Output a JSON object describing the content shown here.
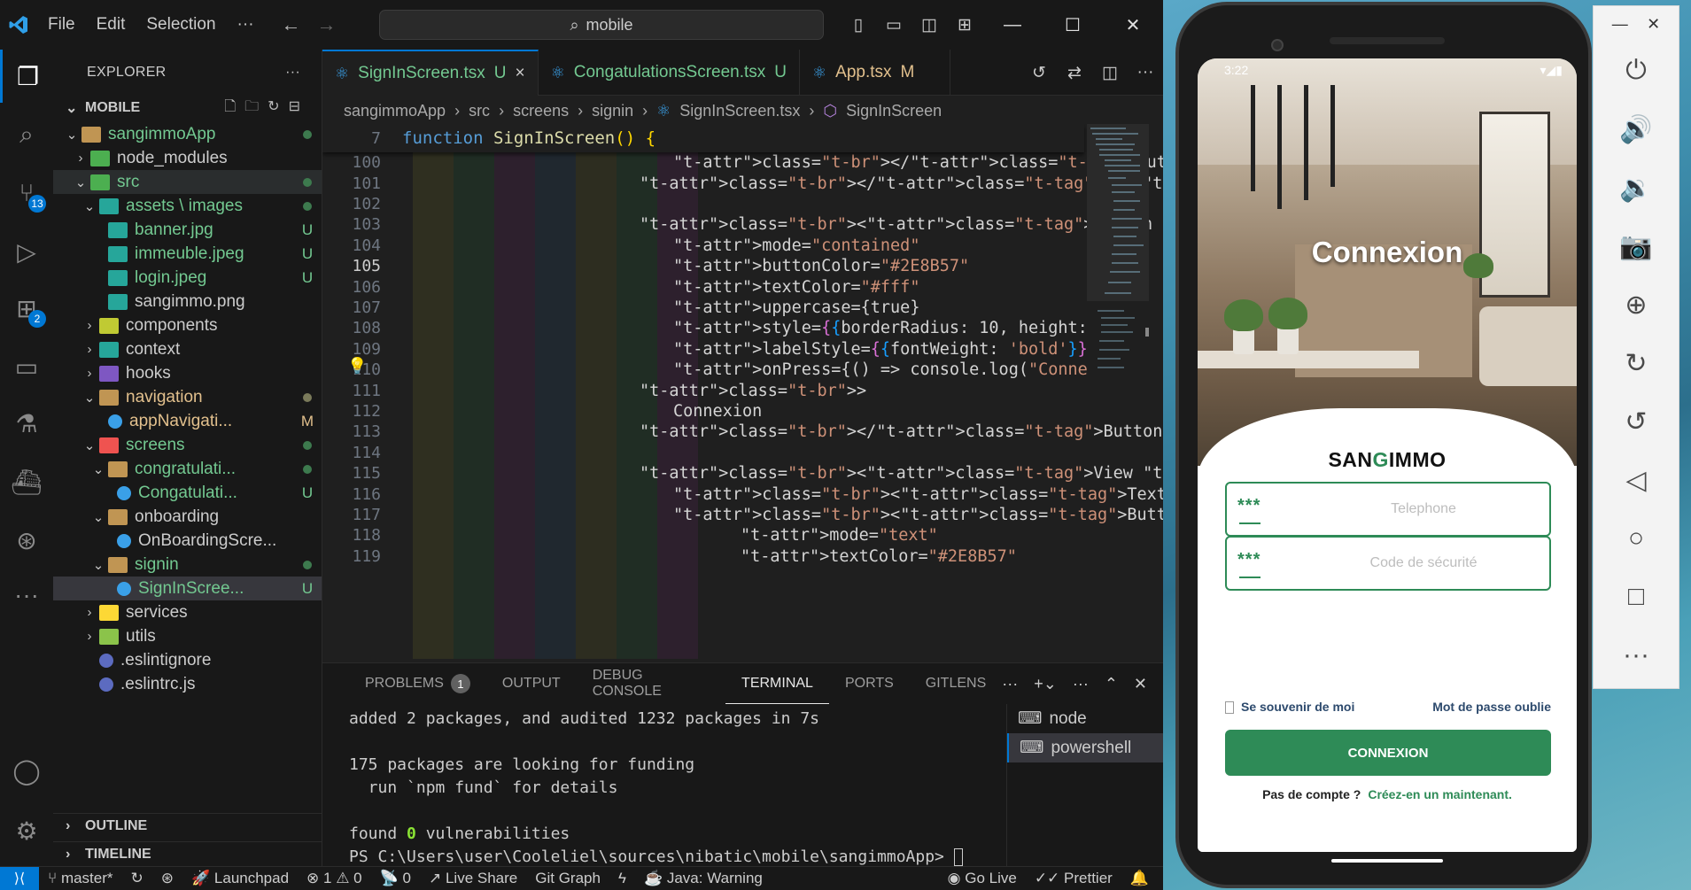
{
  "titlebar": {
    "menu": [
      "File",
      "Edit",
      "Selection",
      "···"
    ],
    "search": "mobile"
  },
  "activity": {
    "scm_badge": "13",
    "ext_badge": "2"
  },
  "explorer": {
    "title": "EXPLORER",
    "section": "MOBILE",
    "outline": "OUTLINE",
    "timeline": "TIMELINE",
    "tree": [
      {
        "label": "sangimmoApp",
        "depth": 1,
        "twisty": "v",
        "status": "dot",
        "icon": "folder"
      },
      {
        "label": "node_modules",
        "depth": 2,
        "twisty": ">",
        "status": "",
        "icon": "folder-green"
      },
      {
        "label": "src",
        "depth": 2,
        "twisty": "v",
        "status": "dot",
        "icon": "folder-src",
        "hover": true
      },
      {
        "label": "assets \\ images",
        "depth": 3,
        "twisty": "v",
        "status": "dot",
        "icon": "folder-images"
      },
      {
        "label": "banner.jpg",
        "depth": 4,
        "twisty": "",
        "status": "U",
        "icon": "image"
      },
      {
        "label": "immeuble.jpeg",
        "depth": 4,
        "twisty": "",
        "status": "U",
        "icon": "image"
      },
      {
        "label": "login.jpeg",
        "depth": 4,
        "twisty": "",
        "status": "U",
        "icon": "image"
      },
      {
        "label": "sangimmo.png",
        "depth": 4,
        "twisty": "",
        "status": "",
        "icon": "image"
      },
      {
        "label": "components",
        "depth": 3,
        "twisty": ">",
        "status": "",
        "icon": "folder-components"
      },
      {
        "label": "context",
        "depth": 3,
        "twisty": ">",
        "status": "",
        "icon": "folder-context"
      },
      {
        "label": "hooks",
        "depth": 3,
        "twisty": ">",
        "status": "",
        "icon": "folder-hooks"
      },
      {
        "label": "navigation",
        "depth": 3,
        "twisty": "v",
        "status": "dot-mod",
        "icon": "folder"
      },
      {
        "label": "appNavigati...",
        "depth": 4,
        "twisty": "",
        "status": "M",
        "icon": "react"
      },
      {
        "label": "screens",
        "depth": 3,
        "twisty": "v",
        "status": "dot",
        "icon": "folder-screens"
      },
      {
        "label": "congratulati...",
        "depth": 4,
        "twisty": "v",
        "status": "dot",
        "icon": "folder"
      },
      {
        "label": "Congatulati...",
        "depth": 5,
        "twisty": "",
        "status": "U",
        "icon": "react"
      },
      {
        "label": "onboarding",
        "depth": 4,
        "twisty": "v",
        "status": "",
        "icon": "folder"
      },
      {
        "label": "OnBoardingScre...",
        "depth": 5,
        "twisty": "",
        "status": "",
        "icon": "react"
      },
      {
        "label": "signin",
        "depth": 4,
        "twisty": "v",
        "status": "dot",
        "icon": "folder"
      },
      {
        "label": "SignInScree...",
        "depth": 5,
        "twisty": "",
        "status": "U",
        "icon": "react",
        "selected": true
      },
      {
        "label": "services",
        "depth": 3,
        "twisty": ">",
        "status": "",
        "icon": "folder-services"
      },
      {
        "label": "utils",
        "depth": 3,
        "twisty": ">",
        "status": "",
        "icon": "folder-utils"
      },
      {
        "label": ".eslintignore",
        "depth": 3,
        "twisty": "",
        "status": "",
        "icon": "eslint"
      },
      {
        "label": ".eslintrc.js",
        "depth": 3,
        "twisty": "",
        "status": "",
        "icon": "eslint"
      }
    ]
  },
  "tabs": [
    {
      "name": "SignInScreen.tsx",
      "badge": "U",
      "active": true,
      "close": "×"
    },
    {
      "name": "CongatulationsScreen.tsx",
      "badge": "U",
      "active": false
    },
    {
      "name": "App.tsx",
      "badge": "M",
      "active": false
    }
  ],
  "breadcrumb": [
    "sangimmoApp",
    "src",
    "screens",
    "signin",
    "SignInScreen.tsx",
    "SignInScreen"
  ],
  "editor": {
    "sticky": {
      "num": "7",
      "kw": "function",
      "name": "SignInScreen",
      "rest": "() {"
    },
    "current_line": "105",
    "lines": [
      {
        "num": "100",
        "html": "[i]</[t]Button[b]>"
      },
      {
        "num": "101",
        "html": "</View>"
      },
      {
        "num": "102",
        "html": ""
      },
      {
        "num": "103",
        "html": "<Button"
      },
      {
        "num": "104",
        "html": "mode=\"contained\""
      },
      {
        "num": "105",
        "html": "buttonColor=\"#2E8B57\""
      },
      {
        "num": "106",
        "html": "textColor=\"#fff\""
      },
      {
        "num": "107",
        "html": "uppercase={true}"
      },
      {
        "num": "108",
        "html": "style={{borderRadius: 10, height:"
      },
      {
        "num": "109",
        "html": "labelStyle={{fontWeight: 'bold'}}"
      },
      {
        "num": "110",
        "html": "onPress={() => console.log(\"Conne"
      },
      {
        "num": "111",
        "html": ">"
      },
      {
        "num": "112",
        "html": "Connexion"
      },
      {
        "num": "113",
        "html": "</Button>"
      },
      {
        "num": "114",
        "html": ""
      },
      {
        "num": "115",
        "html": "<View style={{flexDirection: \"row\", a"
      },
      {
        "num": "116",
        "html": "<Text style={{fontWeight: \"bold\"}"
      },
      {
        "num": "117",
        "html": "<Button"
      },
      {
        "num": "118",
        "html": "mode=\"text\""
      },
      {
        "num": "119",
        "html": "textColor=\"#2E8B57\""
      }
    ]
  },
  "panel": {
    "tabs": [
      "PROBLEMS",
      "OUTPUT",
      "DEBUG CONSOLE",
      "TERMINAL",
      "PORTS",
      "GITLENS"
    ],
    "problems_count": "1",
    "active_tab": "TERMINAL",
    "terminal_lines": [
      "added 2 packages, and audited 1232 packages in 7s",
      "",
      "175 packages are looking for funding",
      "  run `npm fund` for details",
      "",
      "found 0 vulnerabilities",
      "PS C:\\Users\\user\\Cooleliel\\sources\\nibatic\\mobile\\sangimmoApp> "
    ],
    "terminals": [
      "node",
      "powershell"
    ]
  },
  "statusbar": {
    "branch": "master*",
    "launchpad": "Launchpad",
    "errors": "1",
    "warnings": "0",
    "ports": "0",
    "liveshare": "Live Share",
    "gitgraph": "Git Graph",
    "java": "Java: Warning",
    "golive": "Go Live",
    "prettier": "Prettier"
  },
  "phone": {
    "time": "3:22",
    "screen_title": "Connexion",
    "logo_left": "SAN",
    "logo_mid": "G",
    "logo_right": "IMMO",
    "mask": "***",
    "phone_placeholder": "Telephone",
    "code_placeholder": "Code de sécurité",
    "remember": "Se souvenir de moi",
    "forgot": "Mot de passe oublie",
    "button": "CONNEXION",
    "no_account": "Pas de compte ?",
    "create": "Créez-en un maintenant.",
    "accent": "#2E8B57"
  }
}
